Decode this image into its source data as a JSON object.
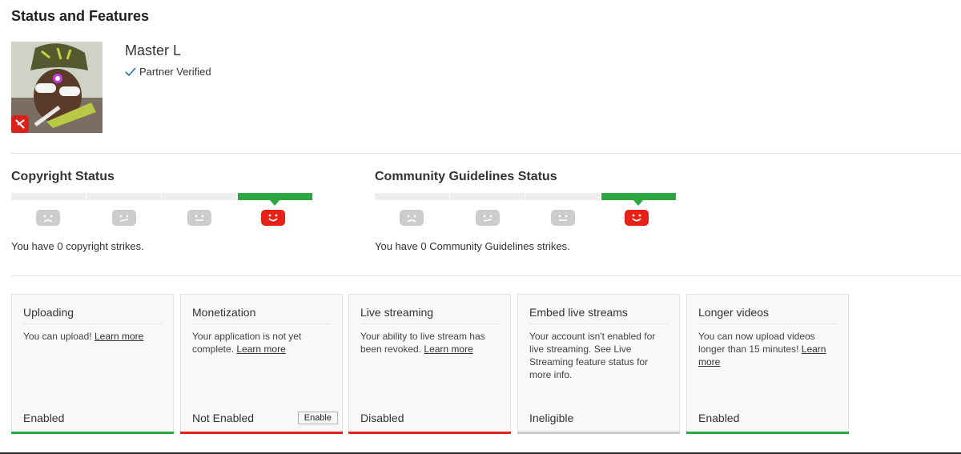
{
  "page": {
    "title": "Status and Features"
  },
  "channel": {
    "name": "Master L",
    "verified_label": "Partner Verified",
    "verified_icon": "checkmark-icon",
    "accent_color": "#1a73a8"
  },
  "copyright": {
    "title": "Copyright Status",
    "strike_text": "You have 0 copyright strikes.",
    "strikes": 0
  },
  "community": {
    "title": "Community Guidelines Status",
    "strike_text": "You have 0 Community Guidelines strikes.",
    "strikes": 0
  },
  "colors": {
    "good": "#2ba640",
    "bad": "#e62117",
    "neutral": "#cccccc"
  },
  "features": [
    {
      "title": "Uploading",
      "description": "You can upload!",
      "link": "Learn more",
      "state": "Enabled",
      "status_color": "#2ba640"
    },
    {
      "title": "Monetization",
      "description": "Your application is not yet complete.",
      "link": "Learn more",
      "state": "Not Enabled",
      "button": "Enable",
      "status_color": "#e62117"
    },
    {
      "title": "Live streaming",
      "description": "Your ability to live stream has been revoked.",
      "link": "Learn more",
      "state": "Disabled",
      "status_color": "#e62117"
    },
    {
      "title": "Embed live streams",
      "description": "Your account isn't enabled for live streaming. See Live Streaming feature status for more info.",
      "link": "",
      "state": "Ineligible",
      "status_color": "#cccccc"
    },
    {
      "title": "Longer videos",
      "description": "You can now upload videos longer than 15 minutes!",
      "link": "Learn more",
      "state": "Enabled",
      "status_color": "#2ba640"
    }
  ]
}
